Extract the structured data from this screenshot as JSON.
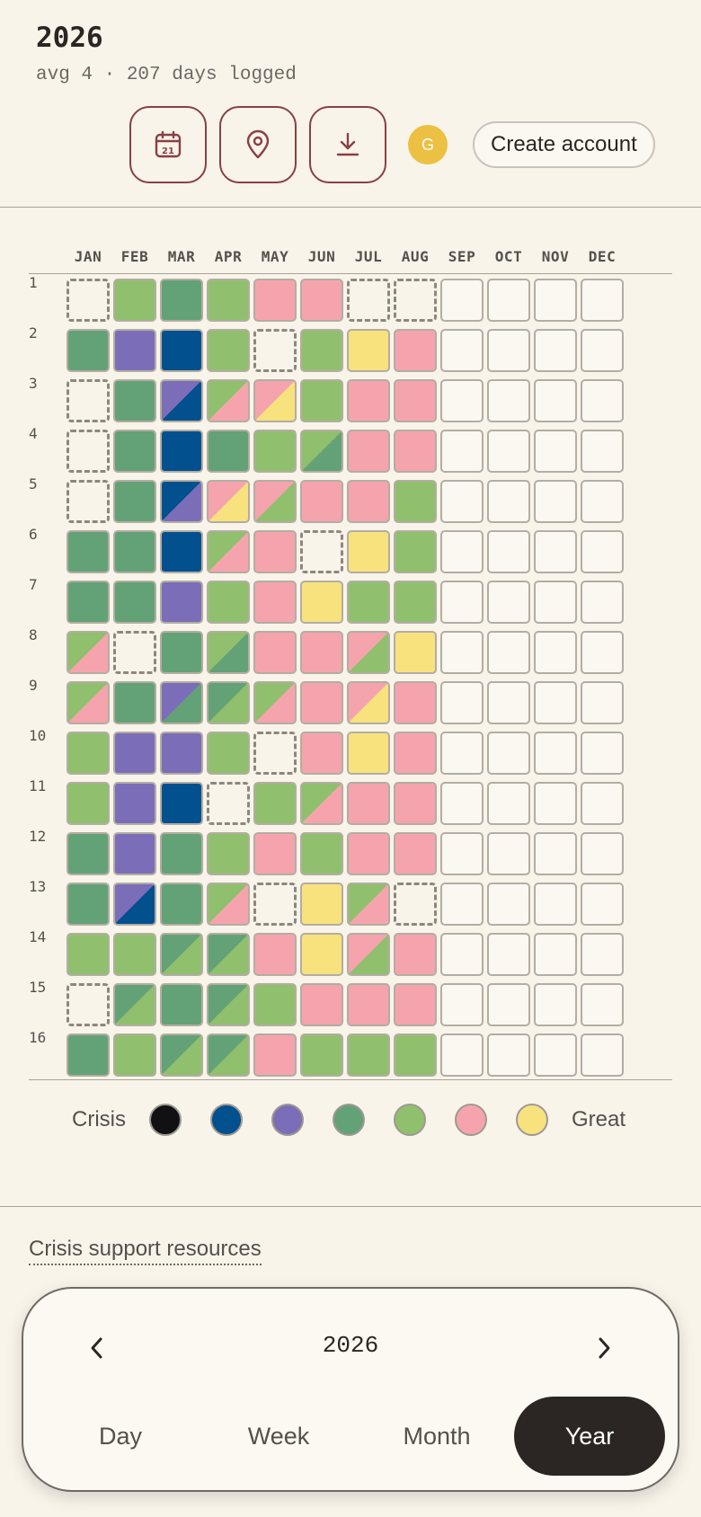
{
  "header": {
    "title": "2026",
    "subtitle": "avg 4 · 207 days logged"
  },
  "toolbar": {
    "avatar_initial": "G",
    "create_account_label": "Create account",
    "icons": [
      "calendar-icon",
      "location-pin-icon",
      "download-icon"
    ]
  },
  "months": [
    "JAN",
    "FEB",
    "MAR",
    "APR",
    "MAY",
    "JUN",
    "JUL",
    "AUG",
    "SEP",
    "OCT",
    "NOV",
    "DEC"
  ],
  "colors": {
    "1": "#111113",
    "2": "#02508e",
    "3": "#7b6db8",
    "4": "#63a276",
    "5": "#90c06d",
    "6": "#f5a4ad",
    "7": "#f7e27e"
  },
  "days": [
    [
      "x",
      "5",
      "4",
      "5",
      "6",
      "6",
      "x",
      "x",
      "e",
      "e",
      "e",
      "e"
    ],
    [
      "4",
      "3",
      "2",
      "5",
      "x",
      "5",
      "7",
      "6",
      "e",
      "e",
      "e",
      "e"
    ],
    [
      "x",
      "4",
      "3/2",
      "5/6",
      "6/7",
      "5",
      "6",
      "6",
      "e",
      "e",
      "e",
      "e"
    ],
    [
      "x",
      "4",
      "2",
      "4",
      "5",
      "5/4",
      "6",
      "6",
      "e",
      "e",
      "e",
      "e"
    ],
    [
      "x",
      "4",
      "2/3",
      "6/7",
      "6/5",
      "6",
      "6",
      "5",
      "e",
      "e",
      "e",
      "e"
    ],
    [
      "4",
      "4",
      "2",
      "5/6",
      "6",
      "x",
      "7",
      "5",
      "e",
      "e",
      "e",
      "e"
    ],
    [
      "4",
      "4",
      "3",
      "5",
      "6",
      "7",
      "5",
      "5",
      "e",
      "e",
      "e",
      "e"
    ],
    [
      "5/6",
      "x",
      "4",
      "5/4",
      "6",
      "6",
      "6/5",
      "7",
      "e",
      "e",
      "e",
      "e"
    ],
    [
      "5/6",
      "4",
      "3/4",
      "4/5",
      "5/6",
      "6",
      "6/7",
      "6",
      "e",
      "e",
      "e",
      "e"
    ],
    [
      "5",
      "3",
      "3",
      "5",
      "x",
      "6",
      "7",
      "6",
      "e",
      "e",
      "e",
      "e"
    ],
    [
      "5",
      "3",
      "2",
      "x",
      "5",
      "5/6",
      "6",
      "6",
      "e",
      "e",
      "e",
      "e"
    ],
    [
      "4",
      "3",
      "4",
      "5",
      "6",
      "5",
      "6",
      "6",
      "e",
      "e",
      "e",
      "e"
    ],
    [
      "4",
      "3/2",
      "4",
      "5/6",
      "x",
      "7",
      "5/6",
      "x",
      "e",
      "e",
      "e",
      "e"
    ],
    [
      "5",
      "5",
      "4/5",
      "4/5",
      "6",
      "7",
      "6/5",
      "6",
      "e",
      "e",
      "e",
      "e"
    ],
    [
      "x",
      "4/5",
      "4",
      "4/5",
      "5",
      "6",
      "6",
      "6",
      "e",
      "e",
      "e",
      "e"
    ],
    [
      "4",
      "5",
      "4/5",
      "4/5",
      "6",
      "5",
      "5",
      "5",
      "e",
      "e",
      "e",
      "e"
    ]
  ],
  "legend": {
    "low_label": "Crisis",
    "high_label": "Great",
    "scale": [
      "1",
      "2",
      "3",
      "4",
      "5",
      "6",
      "7"
    ]
  },
  "footer": {
    "crisis_link": "Crisis support resources"
  },
  "bottom_panel": {
    "year": "2026",
    "views": [
      "Day",
      "Week",
      "Month",
      "Year"
    ],
    "active_view": "Year"
  }
}
